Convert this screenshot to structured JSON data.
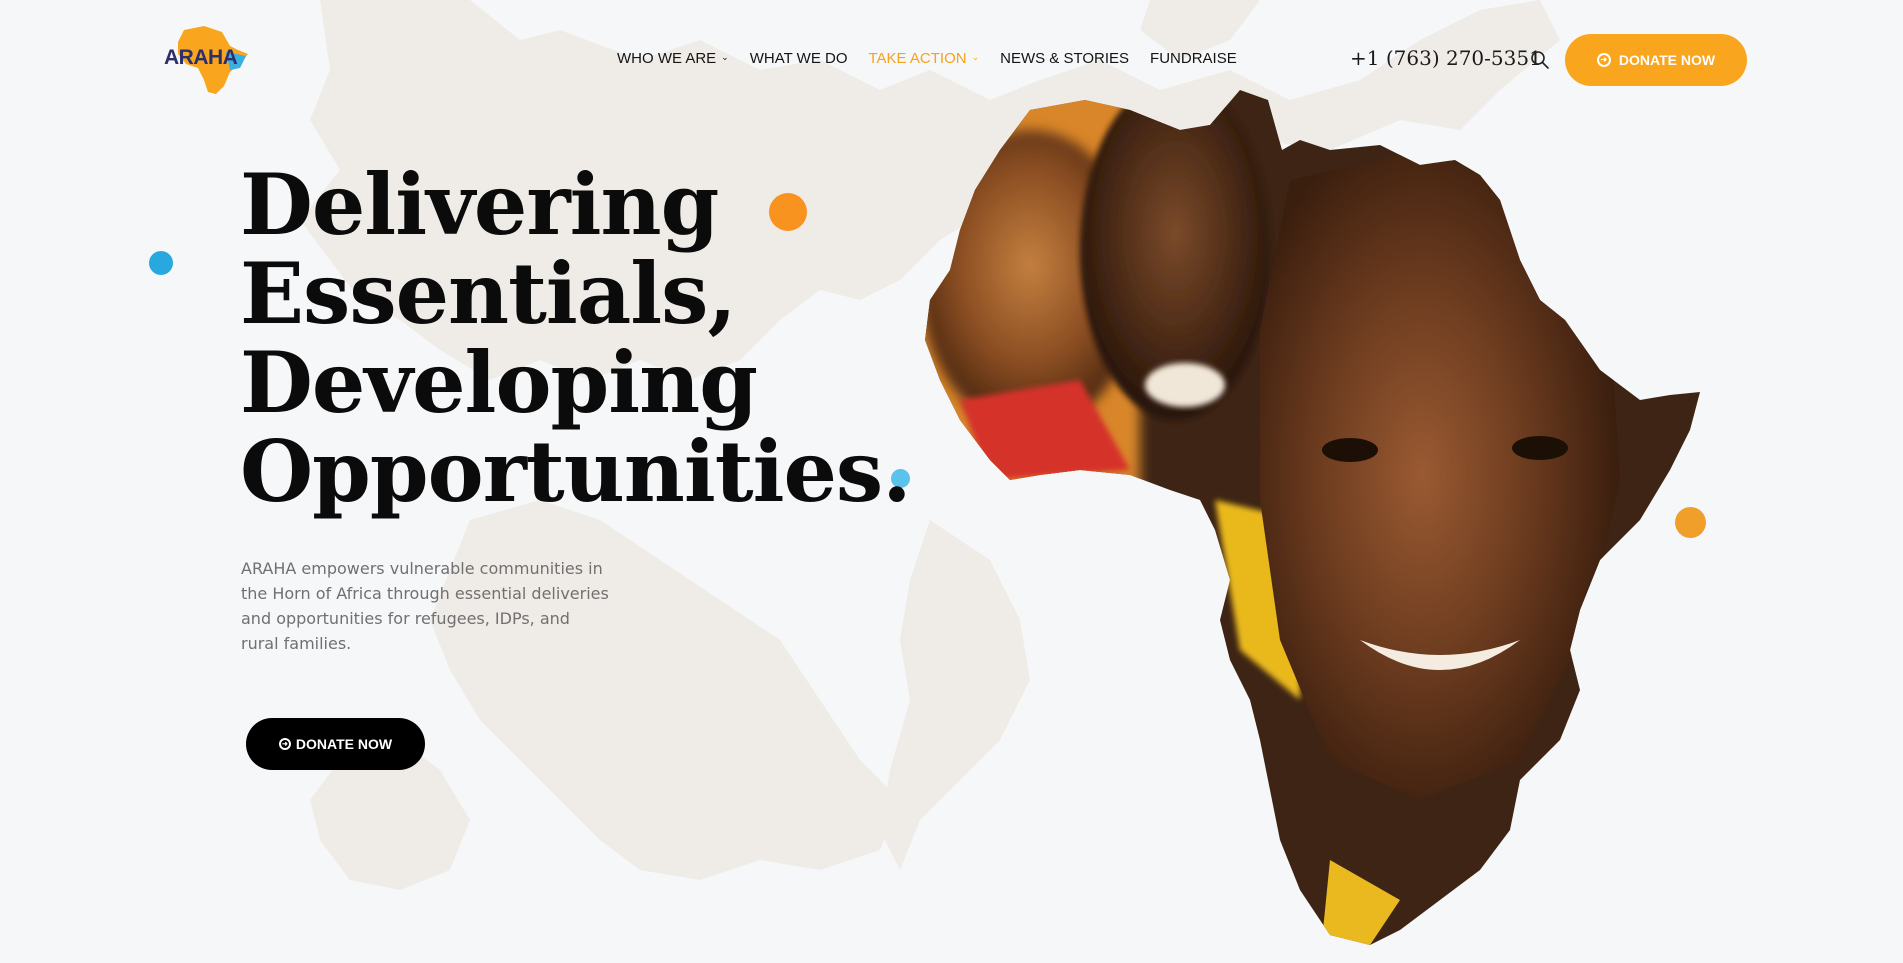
{
  "brand": {
    "logo_text": "ARAHA",
    "accent_color": "#f9a51d",
    "blue_color": "#2aa4e0"
  },
  "nav": {
    "items": [
      {
        "label": "WHO WE ARE",
        "has_dropdown": true,
        "active": false
      },
      {
        "label": "WHAT WE DO",
        "has_dropdown": false,
        "active": false
      },
      {
        "label": "TAKE ACTION",
        "has_dropdown": true,
        "active": true
      },
      {
        "label": "NEWS & STORIES",
        "has_dropdown": false,
        "active": false
      },
      {
        "label": "FUNDRAISE",
        "has_dropdown": false,
        "active": false
      }
    ],
    "chevron_glyph": "⌄"
  },
  "header": {
    "phone": "+1 (763) 270-5351",
    "search_icon": "search-icon",
    "donate_label": "DONATE NOW"
  },
  "hero": {
    "title_lines": [
      "Delivering",
      "Essentials,",
      "Developing",
      "Opportunities."
    ],
    "description": "ARAHA empowers vulnerable communities in the Horn of Africa through essential deliveries and opportunities for refugees, IDPs, and rural families.",
    "donate_label": "DONATE NOW"
  },
  "decor": {
    "dot_colors": {
      "orange": "#f7931e",
      "blue": "#29a8e0",
      "light_blue": "#5bc2ec"
    }
  }
}
